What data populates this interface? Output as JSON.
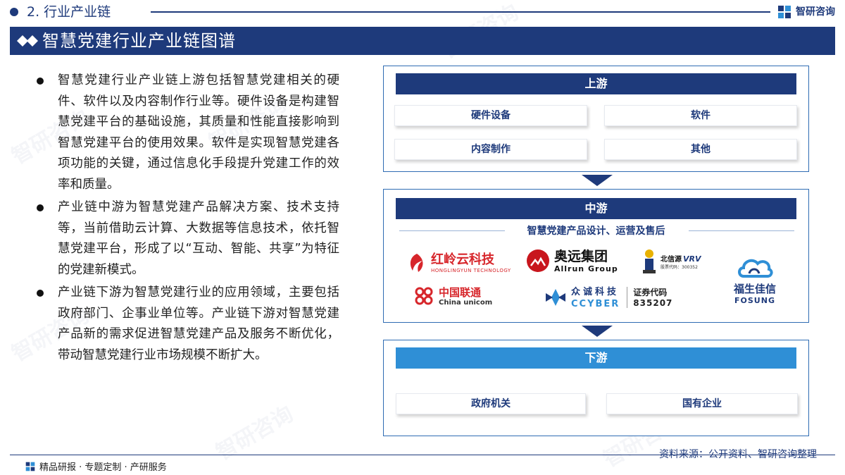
{
  "header": {
    "section_label": "2. 行业产业链",
    "brand_name": "智研咨询",
    "page_title": "智慧党建行业产业链图谱"
  },
  "bullets": [
    "智慧党建行业产业链上游包括智慧党建相关的硬件、软件以及内容制作行业等。硬件设备是构建智慧党建平台的基础设施，其质量和性能直接影响到智慧党建平台的使用效果。软件是实现智慧党建各项功能的关键，通过信息化手段提升党建工作的效率和质量。",
    "产业链中游为智慧党建产品解决方案、技术支持等，当前借助云计算、大数据等信息技术，依托智慧党建平台，形成了以“互动、智能、共享”为特征的党建新模式。",
    "产业链下游为智慧党建行业的应用领域，主要包括政府部门、企事业单位等。产业链下游对智慧党建产品新的需求促进智慧党建产品及服务不断优化，带动智慧党建行业市场规模不断扩大。"
  ],
  "upstream": {
    "title": "上游",
    "items": [
      "硬件设备",
      "软件",
      "内容制作",
      "其他"
    ]
  },
  "midstream": {
    "title": "中游",
    "subtitle": "智慧党建产品设计、运营及售后",
    "logos": {
      "honglingyun": {
        "name": "红岭云科技",
        "sub": "HONGLINGYUN TECHNOLOGY"
      },
      "allrun": {
        "name": "奥远集团",
        "sub": "Allrun Group"
      },
      "beixinyuan": {
        "name": "北信源",
        "mark": "VRV",
        "code": "股票代码：300352"
      },
      "fosung": {
        "name": "福生佳信",
        "sub": "FOSUNG"
      },
      "unicom": {
        "name": "中国联通",
        "sub": "China unicom"
      },
      "ccyber": {
        "name": "众诚科技",
        "sub": "CCYBER",
        "code_label": "证券代码",
        "code": "835207"
      }
    }
  },
  "downstream": {
    "title": "下游",
    "items": [
      "政府机关",
      "国有企业"
    ]
  },
  "footer": {
    "source": "资料来源：公开资料、智研咨询整理",
    "note": "精品研报 · 专题定制 · 产研服务"
  },
  "colors": {
    "navy": "#1e3a7b",
    "blue": "#2f8fd6",
    "border": "#2f6cb3"
  },
  "watermark": "智研咨询"
}
